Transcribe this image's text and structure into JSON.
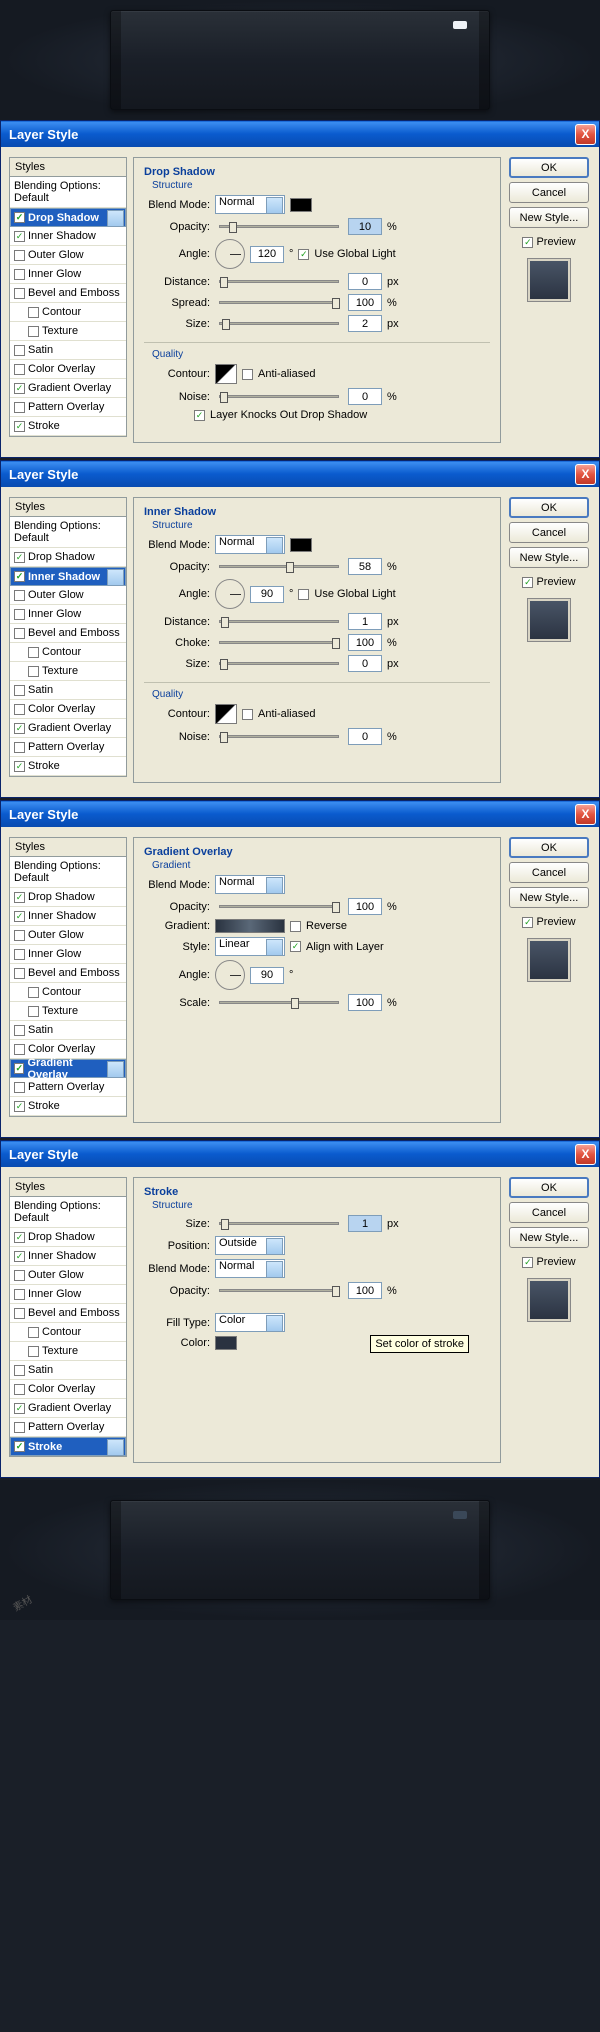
{
  "dialog_title": "Layer Style",
  "styles_header": "Styles",
  "blending_opts": "Blending Options: Default",
  "effects": [
    "Drop Shadow",
    "Inner Shadow",
    "Outer Glow",
    "Inner Glow",
    "Bevel and Emboss",
    "Contour",
    "Texture",
    "Satin",
    "Color Overlay",
    "Gradient Overlay",
    "Pattern Overlay",
    "Stroke"
  ],
  "buttons": {
    "ok": "OK",
    "cancel": "Cancel",
    "newstyle": "New Style...",
    "preview": "Preview"
  },
  "common": {
    "blend_label": "Blend Mode:",
    "opacity": "Opacity:",
    "angle": "Angle:",
    "distance": "Distance:",
    "size": "Size:",
    "contour": "Contour:",
    "noise": "Noise:",
    "anti": "Anti-aliased",
    "pct": "%",
    "px": "px",
    "deg": "°",
    "normal": "Normal",
    "quality": "Quality",
    "structure": "Structure"
  },
  "panels": [
    {
      "title": "Drop Shadow",
      "selected": "Drop Shadow",
      "checked": [
        "Drop Shadow",
        "Inner Shadow",
        "Gradient Overlay",
        "Stroke"
      ],
      "opacity": "10",
      "angle": "120",
      "global": "Use Global Light",
      "global_on": true,
      "rows": [
        [
          "Distance:",
          "0",
          "px"
        ],
        [
          "Spread:",
          "100",
          "%"
        ],
        [
          "Size:",
          "2",
          "px"
        ]
      ],
      "noise": "0",
      "knock": "Layer Knocks Out Drop Shadow"
    },
    {
      "title": "Inner Shadow",
      "selected": "Inner Shadow",
      "checked": [
        "Drop Shadow",
        "Inner Shadow",
        "Gradient Overlay",
        "Stroke"
      ],
      "opacity": "58",
      "angle": "90",
      "global": "Use Global Light",
      "global_on": false,
      "rows": [
        [
          "Distance:",
          "1",
          "px"
        ],
        [
          "Choke:",
          "100",
          "%"
        ],
        [
          "Size:",
          "0",
          "px"
        ]
      ],
      "noise": "0"
    },
    {
      "title": "Gradient Overlay",
      "selected": "Gradient Overlay",
      "sub": "Gradient",
      "checked": [
        "Drop Shadow",
        "Inner Shadow",
        "Gradient Overlay",
        "Stroke"
      ],
      "opacity": "100",
      "reverse": "Reverse",
      "style_lbl": "Style:",
      "linear": "Linear",
      "align": "Align with Layer",
      "angle": "90",
      "scale_lbl": "Scale:",
      "scale": "100",
      "grad_lbl": "Gradient:"
    },
    {
      "title": "Stroke",
      "selected": "Stroke",
      "checked": [
        "Drop Shadow",
        "Inner Shadow",
        "Gradient Overlay",
        "Stroke"
      ],
      "size": "1",
      "pos_lbl": "Position:",
      "pos": "Outside",
      "opacity": "100",
      "fill_lbl": "Fill Type:",
      "fill": "Color",
      "color_lbl": "Color:",
      "tooltip": "Set color of stroke"
    }
  ]
}
